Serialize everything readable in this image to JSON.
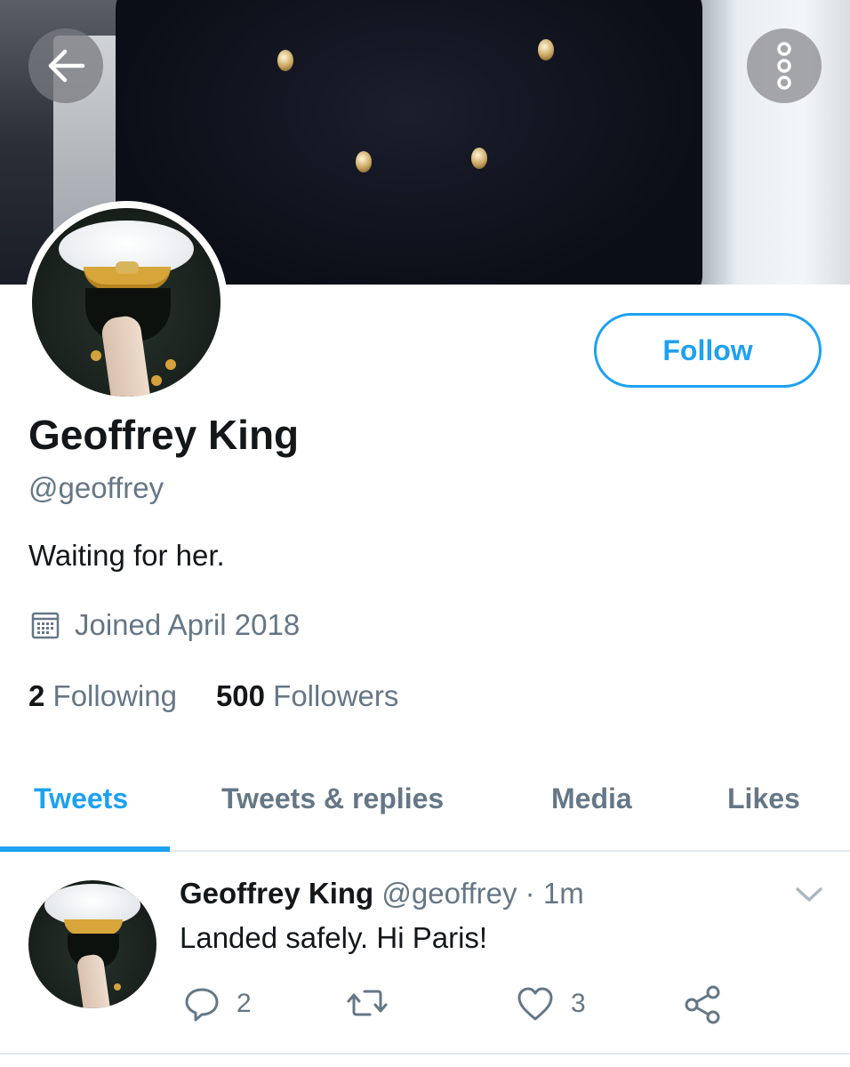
{
  "header": {
    "back_icon": "arrow-left-icon",
    "more_icon": "more-vertical-icon"
  },
  "profile": {
    "name": "Geoffrey King",
    "handle": "@geoffrey",
    "bio": "Waiting for her.",
    "joined": "Joined April 2018",
    "joined_icon": "calendar-icon",
    "following_count": "2",
    "following_label": "Following",
    "followers_count": "500",
    "followers_label": "Followers",
    "follow_label": "Follow"
  },
  "tabs": [
    {
      "label": "Tweets",
      "active": true
    },
    {
      "label": "Tweets & replies",
      "active": false
    },
    {
      "label": "Media",
      "active": false
    },
    {
      "label": "Likes",
      "active": false
    }
  ],
  "tweet": {
    "name": "Geoffrey King",
    "meta": "@geoffrey · 1m",
    "text": "Landed safely. Hi Paris!",
    "replies": "2",
    "retweets": "",
    "likes": "3"
  },
  "colors": {
    "accent": "#1da1f2",
    "secondary_text": "#657786",
    "primary_text": "#14171a"
  }
}
